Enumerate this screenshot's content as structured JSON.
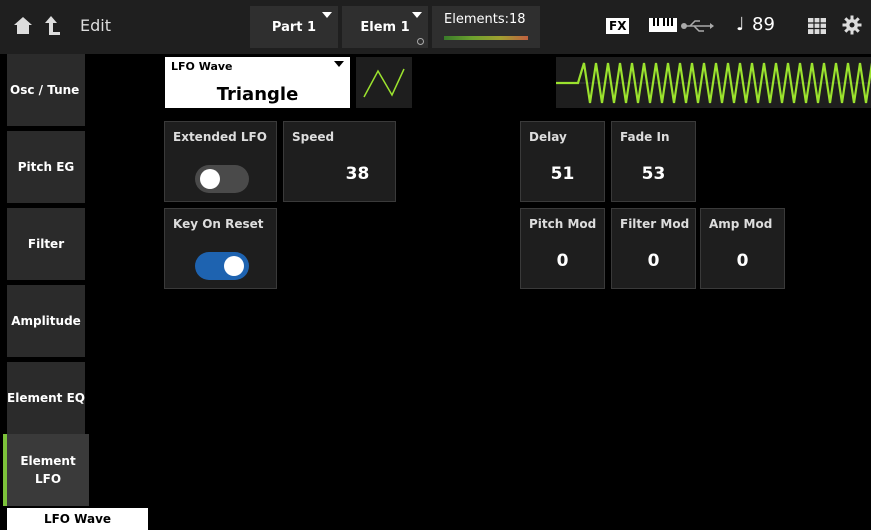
{
  "header": {
    "title": "Edit",
    "part_label": "Part 1",
    "elem_label": "Elem 1",
    "elements_label": "Elements:18",
    "fx_label": "FX",
    "tempo_symbol": "♩",
    "tempo": "89"
  },
  "sidebar": {
    "items": [
      {
        "label": "Osc / Tune"
      },
      {
        "label": "Pitch EG"
      },
      {
        "label": "Filter"
      },
      {
        "label": "Amplitude"
      },
      {
        "label": "Element EQ"
      },
      {
        "label": "Element LFO"
      }
    ]
  },
  "lfo": {
    "wave_label": "LFO Wave",
    "wave_value": "Triangle",
    "extended_label": "Extended LFO",
    "extended_on": false,
    "speed_label": "Speed",
    "speed_value": "38",
    "key_on_reset_label": "Key On Reset",
    "key_on_reset_on": true,
    "delay_label": "Delay",
    "delay_value": "51",
    "fade_in_label": "Fade In",
    "fade_in_value": "53",
    "pitch_mod_label": "Pitch Mod",
    "pitch_mod_value": "0",
    "filter_mod_label": "Filter Mod",
    "filter_mod_value": "0",
    "amp_mod_label": "Amp Mod",
    "amp_mod_value": "0"
  },
  "bottom_tab": {
    "label": "LFO Wave"
  },
  "colors": {
    "accent": "#7cc23a",
    "wave": "#9be22e",
    "toggle_on": "#1e63b0"
  }
}
